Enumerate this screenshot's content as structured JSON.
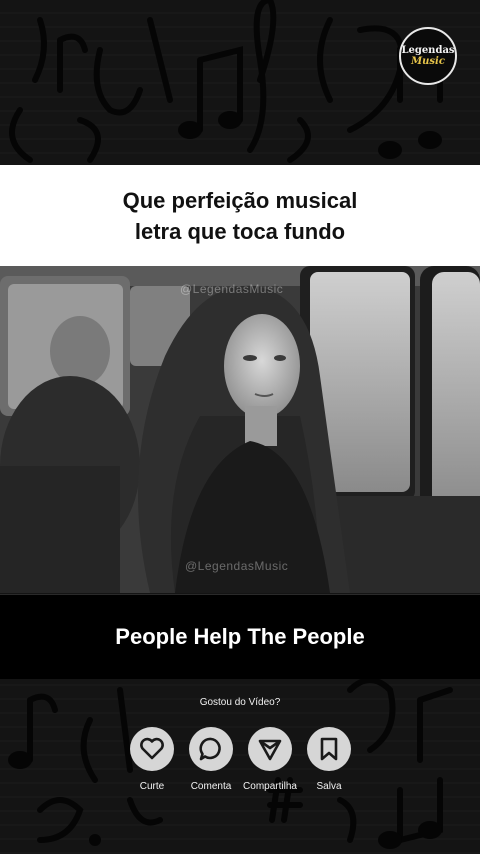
{
  "logo": {
    "line1": "Legendas",
    "line2": "Music"
  },
  "headline": {
    "line1": "Que perfeição musical",
    "line2": "letra que toca fundo"
  },
  "watermark": {
    "text": "@LegendasMusic"
  },
  "song": {
    "title": "People Help The People"
  },
  "prompt": {
    "question": "Gostou do Vídeo?"
  },
  "actions": [
    {
      "label": "Curte",
      "icon": "heart-icon"
    },
    {
      "label": "Comenta",
      "icon": "comment-icon"
    },
    {
      "label": "Compartilha",
      "icon": "share-icon"
    },
    {
      "label": "Salva",
      "icon": "bookmark-icon"
    }
  ],
  "colors": {
    "background": "#121212",
    "banner": "#ffffff",
    "button": "#d6d6d6",
    "logo_accent": "#e6c44a"
  }
}
